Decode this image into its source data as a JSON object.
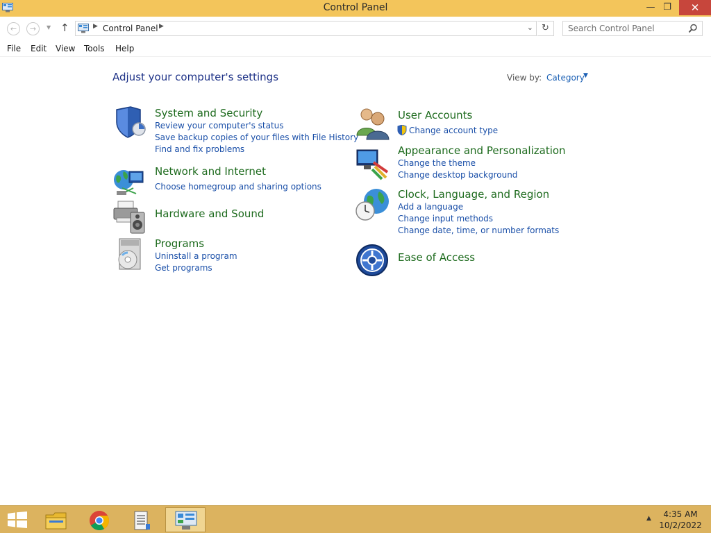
{
  "window": {
    "title": "Control Panel",
    "minimize": "—",
    "maximize": "❐",
    "close": "✕"
  },
  "address": {
    "path": "Control Panel",
    "search_placeholder": "Search Control Panel"
  },
  "menu": [
    "File",
    "Edit",
    "View",
    "Tools",
    "Help"
  ],
  "content": {
    "heading": "Adjust your computer's settings",
    "view_by_label": "View by:",
    "view_by_value": "Category"
  },
  "categories": [
    {
      "title": "System and Security",
      "icon": "shield-icon",
      "links": [
        "Review your computer's status",
        "Save backup copies of your files with File History",
        "Find and fix problems"
      ]
    },
    {
      "title": "Network and Internet",
      "icon": "network-globe-icon",
      "links": [
        "Choose homegroup and sharing options"
      ]
    },
    {
      "title": "Hardware and Sound",
      "icon": "printer-speaker-icon",
      "links": []
    },
    {
      "title": "Programs",
      "icon": "programs-disc-icon",
      "links": [
        "Uninstall a program",
        "Get programs"
      ]
    },
    {
      "title": "User Accounts",
      "icon": "users-icon",
      "links": [
        "Change account type"
      ]
    },
    {
      "title": "Appearance and Personalization",
      "icon": "monitor-palette-icon",
      "links": [
        "Change the theme",
        "Change desktop background"
      ]
    },
    {
      "title": "Clock, Language, and Region",
      "icon": "clock-globe-icon",
      "links": [
        "Add a language",
        "Change input methods",
        "Change date, time, or number formats"
      ]
    },
    {
      "title": "Ease of Access",
      "icon": "ease-of-access-icon",
      "links": []
    }
  ],
  "taskbar": {
    "items": [
      "start-icon",
      "file-explorer-icon",
      "chrome-icon",
      "notepad-icon",
      "control-panel-icon"
    ],
    "time": "4:35 AM",
    "date": "10/2/2022"
  },
  "colors": {
    "titlebar": "#f3c55b",
    "taskbar": "#dcb35f",
    "heading": "#1e3287",
    "category_title": "#1e6b1e",
    "link": "#1a4fa8"
  }
}
